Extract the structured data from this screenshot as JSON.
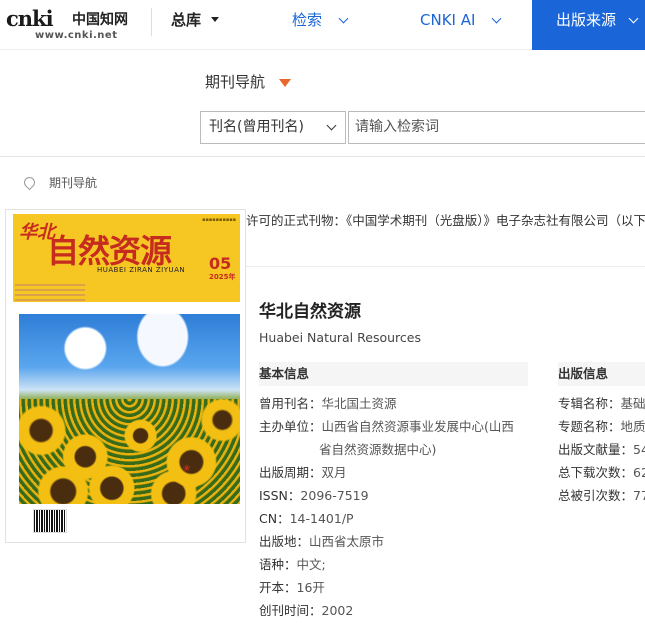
{
  "logo": {
    "mark": "cnki",
    "chinese": "中国知网",
    "url": "www.cnki.net"
  },
  "nav": {
    "zongku": "总库",
    "jiansuo": "检索",
    "cnki_ai": "CNKI AI",
    "active": "出版来源"
  },
  "search": {
    "section_title": "期刊导航",
    "field_select": "刊名(曾用刊名)",
    "placeholder": "请输入检索词"
  },
  "breadcrumb": "期刊导航",
  "notice": "许可的正式刊物：《中国学术期刊（光盘版）》电子杂志社有限公司（以下简",
  "cover": {
    "huabei": "华北",
    "title": "自然资源",
    "pinyin": "HUABEI ZIRAN ZIYUAN",
    "issue": "05",
    "year": "2025年",
    "isbn_text": "ISSN 2096-7519"
  },
  "journal": {
    "title": "华北自然资源",
    "english": "Huabei Natural Resources"
  },
  "basic_info": {
    "heading": "基本信息",
    "rows": [
      {
        "label": "曾用刊名：",
        "value": "华北国土资源"
      },
      {
        "label": "主办单位：",
        "value": "山西省自然资源事业发展中心(山西"
      },
      {
        "label": "",
        "value": "省自然资源数据中心)"
      },
      {
        "label": "出版周期：",
        "value": "双月"
      },
      {
        "label": "ISSN：",
        "value": "2096-7519"
      },
      {
        "label": "CN：",
        "value": "14-1401/P"
      },
      {
        "label": "出版地：",
        "value": "山西省太原市"
      },
      {
        "label": "语种：",
        "value": "中文;"
      },
      {
        "label": "开本：",
        "value": "16开"
      },
      {
        "label": "创刊时间：",
        "value": "2002"
      }
    ]
  },
  "pub_info": {
    "heading": "出版信息",
    "rows": [
      {
        "label": "专辑名称：",
        "value": "基础"
      },
      {
        "label": "专题名称：",
        "value": "地质"
      },
      {
        "label": "出版文献量：",
        "value": "54"
      },
      {
        "label": "总下载次数：",
        "value": "62"
      },
      {
        "label": "总被引次数：",
        "value": "77"
      }
    ]
  }
}
